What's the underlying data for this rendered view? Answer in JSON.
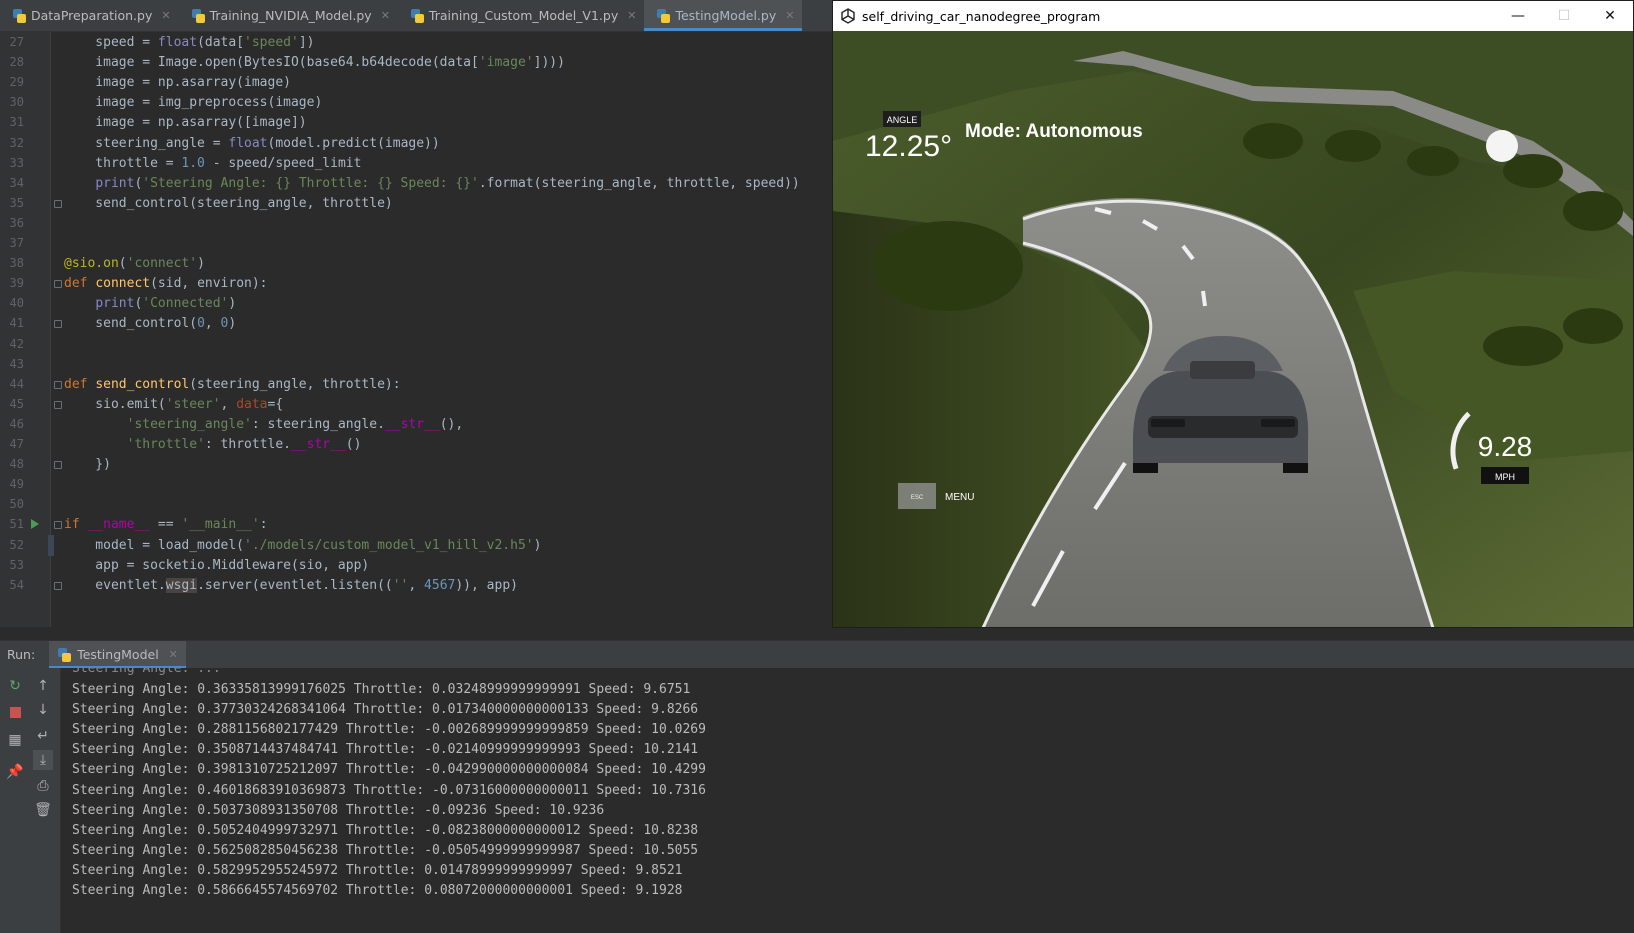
{
  "editor": {
    "tabs": [
      {
        "label": "DataPreparation.py",
        "active": false
      },
      {
        "label": "Training_NVIDIA_Model.py",
        "active": false
      },
      {
        "label": "Training_Custom_Model_V1.py",
        "active": false
      },
      {
        "label": "TestingModel.py",
        "active": true
      }
    ],
    "line_numbers": [
      "27",
      "28",
      "29",
      "30",
      "31",
      "32",
      "33",
      "34",
      "35",
      "36",
      "37",
      "38",
      "39",
      "40",
      "41",
      "42",
      "43",
      "44",
      "45",
      "46",
      "47",
      "48",
      "49",
      "50",
      "51",
      "52",
      "53",
      "54"
    ]
  },
  "code_lines": [
    "    speed = float(data['speed'])",
    "    image = Image.open(BytesIO(base64.b64decode(data['image'])))",
    "    image = np.asarray(image)",
    "    image = img_preprocess(image)",
    "    image = np.asarray([image])",
    "    steering_angle = float(model.predict(image))",
    "    throttle = 1.0 - speed/speed_limit",
    "    print('Steering Angle: {} Throttle: {} Speed: {}'.format(steering_angle, throttle, speed))",
    "    send_control(steering_angle, throttle)",
    "",
    "",
    "@sio.on('connect')",
    "def connect(sid, environ):",
    "    print('Connected')",
    "    send_control(0, 0)",
    "",
    "",
    "def send_control(steering_angle, throttle):",
    "    sio.emit('steer', data={",
    "        'steering_angle': steering_angle.__str__(),",
    "        'throttle': throttle.__str__()",
    "    })",
    "",
    "",
    "if __name__ == '__main__':",
    "    model = load_model('./models/custom_model_v1_hill_v2.h5')",
    "    app = socketio.Middleware(sio, app)",
    "    eventlet.wsgi.server(eventlet.listen(('', 4567)), app)"
  ],
  "sim": {
    "window_title": "self_driving_car_nanodegree_program",
    "angle_label": "ANGLE",
    "angle_value": "12.25°",
    "mode": "Mode: Autonomous",
    "speed_value": "9.28",
    "speed_unit": "MPH",
    "speed_gauge_fraction": 0.3,
    "esc_label": "ESC",
    "menu_label": "MENU"
  },
  "run": {
    "label": "Run:",
    "tab_label": "TestingModel",
    "console_lines": [
      "Steering Angle: 0.36335813999176025 Throttle: 0.03248999999999991 Speed: 9.6751",
      "Steering Angle: 0.37730324268341064 Throttle: 0.017340000000000133 Speed: 9.8266",
      "Steering Angle: 0.2881156802177429 Throttle: -0.002689999999999859 Speed: 10.0269",
      "Steering Angle: 0.3508714437484741 Throttle: -0.02140999999999993 Speed: 10.2141",
      "Steering Angle: 0.3981310725212097 Throttle: -0.042990000000000084 Speed: 10.4299",
      "Steering Angle: 0.46018683910369873 Throttle: -0.07316000000000011 Speed: 10.7316",
      "Steering Angle: 0.5037308931350708 Throttle: -0.09236 Speed: 10.9236",
      "Steering Angle: 0.5052404999732971 Throttle: -0.08238000000000012 Speed: 10.8238",
      "Steering Angle: 0.5625082850456238 Throttle: -0.05054999999999987 Speed: 10.5055",
      "Steering Angle: 0.5829952955245972 Throttle: 0.01478999999999997 Speed: 9.8521",
      "Steering Angle: 0.5866645574569702 Throttle: 0.08072000000000001 Speed: 9.1928"
    ]
  }
}
